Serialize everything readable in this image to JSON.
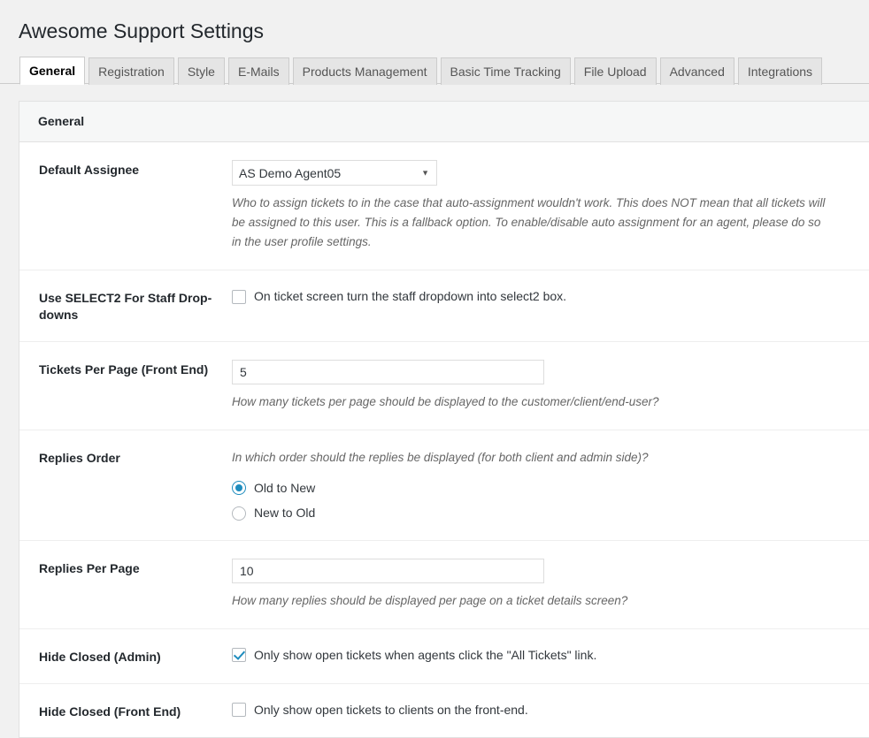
{
  "page": {
    "title": "Awesome Support Settings"
  },
  "tabs": [
    {
      "label": "General",
      "active": true
    },
    {
      "label": "Registration",
      "active": false
    },
    {
      "label": "Style",
      "active": false
    },
    {
      "label": "E-Mails",
      "active": false
    },
    {
      "label": "Products Management",
      "active": false
    },
    {
      "label": "Basic Time Tracking",
      "active": false
    },
    {
      "label": "File Upload",
      "active": false
    },
    {
      "label": "Advanced",
      "active": false
    },
    {
      "label": "Integrations",
      "active": false
    }
  ],
  "panel": {
    "header": "General"
  },
  "settings": {
    "default_assignee": {
      "label": "Default Assignee",
      "value": "AS Demo Agent05",
      "options": [
        "AS Demo Agent05"
      ],
      "description": "Who to assign tickets to in the case that auto-assignment wouldn't work. This does NOT mean that all tickets will be assigned to this user. This is a fallback option. To enable/disable auto assignment for an agent, please do so in the user profile settings."
    },
    "use_select2": {
      "label": "Use SELECT2 For Staff Drop-downs",
      "checkbox_label": "On ticket screen turn the staff dropdown into select2 box.",
      "checked": false
    },
    "tickets_per_page": {
      "label": "Tickets Per Page (Front End)",
      "value": "5",
      "description": "How many tickets per page should be displayed to the customer/client/end-user?"
    },
    "replies_order": {
      "label": "Replies Order",
      "description": "In which order should the replies be displayed (for both client and admin side)?",
      "options": [
        {
          "label": "Old to New",
          "selected": true
        },
        {
          "label": "New to Old",
          "selected": false
        }
      ]
    },
    "replies_per_page": {
      "label": "Replies Per Page",
      "value": "10",
      "description": "How many replies should be displayed per page on a ticket details screen?"
    },
    "hide_closed_admin": {
      "label": "Hide Closed (Admin)",
      "checkbox_label": "Only show open tickets when agents click the \"All Tickets\" link.",
      "checked": true
    },
    "hide_closed_front_end": {
      "label": "Hide Closed (Front End)",
      "checkbox_label": "Only show open tickets to clients on the front-end.",
      "checked": false
    }
  },
  "colors": {
    "accent": "#1e8cbe",
    "page_background": "#f1f1f1",
    "panel_background": "#ffffff",
    "heading_text": "#23282d"
  }
}
